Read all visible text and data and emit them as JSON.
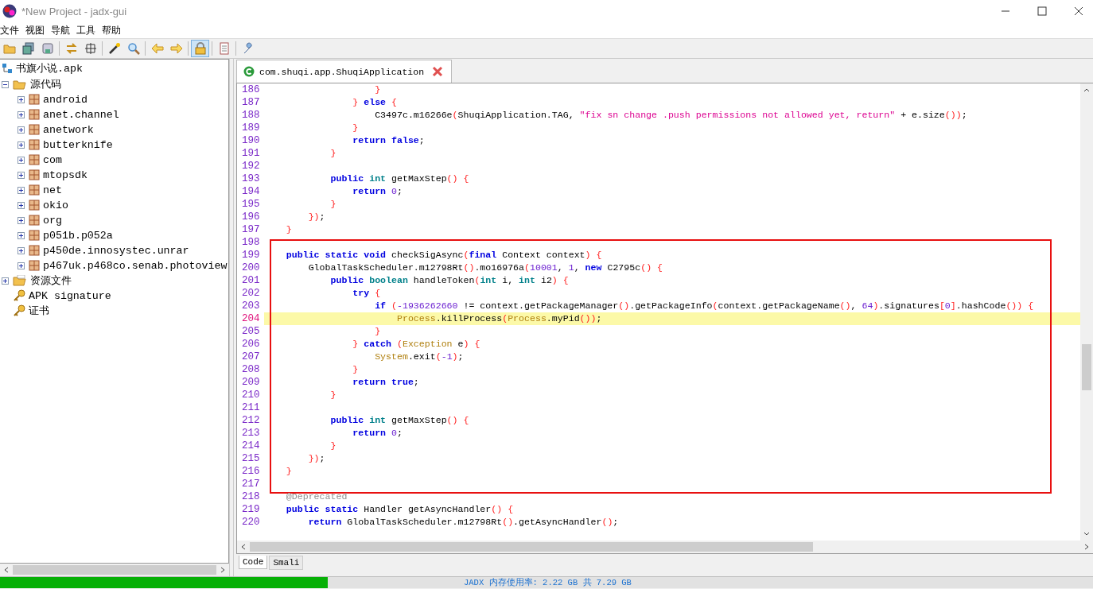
{
  "window": {
    "title": "*New Project - jadx-gui"
  },
  "menu": [
    "文件",
    "视图",
    "导航",
    "工具",
    "帮助"
  ],
  "toolbar": [
    [
      {
        "pressed": false
      },
      {
        "pressed": false
      },
      {
        "pressed": false
      }
    ],
    [
      {
        "pressed": false
      },
      {
        "pressed": false
      }
    ],
    [
      {
        "pressed": false
      },
      {
        "pressed": false
      }
    ],
    [
      {
        "pressed": false
      },
      {
        "pressed": false
      }
    ],
    [
      {
        "pressed": true
      }
    ],
    [
      {
        "pressed": false
      }
    ],
    [
      {
        "pressed": false
      }
    ]
  ],
  "tree": {
    "label": "书旗小说.apk",
    "children": [
      {
        "label": "源代码",
        "kind": "source",
        "expanded": true,
        "children": [
          {
            "label": "android",
            "kind": "package",
            "expanded": false
          },
          {
            "label": "anet.channel",
            "kind": "package",
            "expanded": false
          },
          {
            "label": "anetwork",
            "kind": "package",
            "expanded": false
          },
          {
            "label": "butterknife",
            "kind": "package",
            "expanded": false
          },
          {
            "label": "com",
            "kind": "package",
            "expanded": false
          },
          {
            "label": "mtopsdk",
            "kind": "package",
            "expanded": false
          },
          {
            "label": "net",
            "kind": "package",
            "expanded": false
          },
          {
            "label": "okio",
            "kind": "package",
            "expanded": false
          },
          {
            "label": "org",
            "kind": "package",
            "expanded": false
          },
          {
            "label": "p051b.p052a",
            "kind": "package",
            "expanded": false
          },
          {
            "label": "p450de.innosystec.unrar",
            "kind": "package",
            "expanded": false
          },
          {
            "label": "p467uk.p468co.senab.photoview",
            "kind": "package",
            "expanded": false
          }
        ]
      },
      {
        "label": "资源文件",
        "kind": "resources",
        "expanded": false
      },
      {
        "label": "APK signature",
        "kind": "key"
      },
      {
        "label": "证书",
        "kind": "key"
      }
    ]
  },
  "editor_tab": {
    "label": "com.shuqi.app.ShuqiApplication"
  },
  "code": {
    "sections": [
      {
        "boxed": false,
        "lines": [
          {
            "number": "186",
            "highlighted": false,
            "tokens": [
              {
                "kind": "bracket",
                "text": "                    }"
              }
            ]
          },
          {
            "number": "187",
            "highlighted": false,
            "tokens": [
              {
                "kind": "bracket",
                "text": "                }"
              },
              {
                "kind": "keyword",
                "text": " else"
              },
              {
                "kind": "bracket",
                "text": " {"
              }
            ]
          },
          {
            "number": "188",
            "highlighted": false,
            "tokens": [
              {
                "kind": "plain",
                "text": "                    C3497c.m16266e"
              },
              {
                "kind": "bracket",
                "text": "("
              },
              {
                "kind": "plain",
                "text": "ShuqiApplication.TAG,"
              },
              {
                "kind": "string",
                "text": " \"fix sn change .push permissions not allowed yet, return\""
              },
              {
                "kind": "plain",
                "text": " + e.size"
              },
              {
                "kind": "bracket",
                "text": "())"
              },
              {
                "kind": "plain",
                "text": ";"
              }
            ]
          },
          {
            "number": "189",
            "highlighted": false,
            "tokens": [
              {
                "kind": "bracket",
                "text": "                }"
              }
            ]
          },
          {
            "number": "190",
            "highlighted": false,
            "tokens": [
              {
                "kind": "keyword",
                "text": "                return false"
              },
              {
                "kind": "plain",
                "text": ";"
              }
            ]
          },
          {
            "number": "191",
            "highlighted": false,
            "tokens": [
              {
                "kind": "bracket",
                "text": "            }"
              }
            ]
          },
          {
            "number": "192",
            "highlighted": false
          },
          {
            "number": "193",
            "highlighted": false,
            "tokens": [
              {
                "kind": "keyword",
                "text": "            public"
              },
              {
                "kind": "type",
                "text": " int"
              },
              {
                "kind": "plain",
                "text": " getMaxStep"
              },
              {
                "kind": "bracket",
                "text": "() {"
              }
            ]
          },
          {
            "number": "194",
            "highlighted": false,
            "tokens": [
              {
                "kind": "keyword",
                "text": "                return"
              },
              {
                "kind": "number",
                "text": " 0"
              },
              {
                "kind": "plain",
                "text": ";"
              }
            ]
          },
          {
            "number": "195",
            "highlighted": false,
            "tokens": [
              {
                "kind": "bracket",
                "text": "            }"
              }
            ]
          },
          {
            "number": "196",
            "highlighted": false,
            "tokens": [
              {
                "kind": "bracket",
                "text": "        })"
              },
              {
                "kind": "plain",
                "text": ";"
              }
            ]
          },
          {
            "number": "197",
            "highlighted": false,
            "tokens": [
              {
                "kind": "bracket",
                "text": "    }"
              }
            ]
          }
        ]
      },
      {
        "boxed": true,
        "lines": [
          {
            "number": "198",
            "highlighted": false
          },
          {
            "number": "199",
            "highlighted": false,
            "tokens": [
              {
                "kind": "keyword",
                "text": "    public static void"
              },
              {
                "kind": "plain",
                "text": " checkSigAsync"
              },
              {
                "kind": "bracket",
                "text": "("
              },
              {
                "kind": "keyword",
                "text": "final"
              },
              {
                "kind": "plain",
                "text": " Context context"
              },
              {
                "kind": "bracket",
                "text": ") {"
              }
            ]
          },
          {
            "number": "200",
            "highlighted": false,
            "tokens": [
              {
                "kind": "plain",
                "text": "        GlobalTaskScheduler.m12798Rt"
              },
              {
                "kind": "bracket",
                "text": "()"
              },
              {
                "kind": "plain",
                "text": ".mo16976a"
              },
              {
                "kind": "bracket",
                "text": "("
              },
              {
                "kind": "number",
                "text": "10001"
              },
              {
                "kind": "plain",
                "text": ","
              },
              {
                "kind": "number",
                "text": " 1"
              },
              {
                "kind": "plain",
                "text": ","
              },
              {
                "kind": "keyword",
                "text": " new"
              },
              {
                "kind": "plain",
                "text": " C2795c"
              },
              {
                "kind": "bracket",
                "text": "() {"
              }
            ]
          },
          {
            "number": "201",
            "highlighted": false,
            "tokens": [
              {
                "kind": "keyword",
                "text": "            public"
              },
              {
                "kind": "type",
                "text": " boolean"
              },
              {
                "kind": "plain",
                "text": " handleToken"
              },
              {
                "kind": "bracket",
                "text": "("
              },
              {
                "kind": "type",
                "text": "int"
              },
              {
                "kind": "plain",
                "text": " i,"
              },
              {
                "kind": "type",
                "text": " int"
              },
              {
                "kind": "plain",
                "text": " i2"
              },
              {
                "kind": "bracket",
                "text": ") {"
              }
            ]
          },
          {
            "number": "202",
            "highlighted": false,
            "tokens": [
              {
                "kind": "keyword",
                "text": "                try"
              },
              {
                "kind": "bracket",
                "text": " {"
              }
            ]
          },
          {
            "number": "203",
            "highlighted": false,
            "tokens": [
              {
                "kind": "keyword",
                "text": "                    if"
              },
              {
                "kind": "bracket",
                "text": " ("
              },
              {
                "kind": "number",
                "text": "-1936262660"
              },
              {
                "kind": "plain",
                "text": " != context.getPackageManager"
              },
              {
                "kind": "bracket",
                "text": "()"
              },
              {
                "kind": "plain",
                "text": ".getPackageInfo"
              },
              {
                "kind": "bracket",
                "text": "("
              },
              {
                "kind": "plain",
                "text": "context.getPackageName"
              },
              {
                "kind": "bracket",
                "text": "()"
              },
              {
                "kind": "plain",
                "text": ","
              },
              {
                "kind": "number",
                "text": " 64"
              },
              {
                "kind": "bracket",
                "text": ")"
              },
              {
                "kind": "plain",
                "text": ".signatures"
              },
              {
                "kind": "bracket",
                "text": "["
              },
              {
                "kind": "number",
                "text": "0"
              },
              {
                "kind": "bracket",
                "text": "]"
              },
              {
                "kind": "plain",
                "text": ".hashCode"
              },
              {
                "kind": "bracket",
                "text": "()) {"
              }
            ]
          },
          {
            "number": "204",
            "highlighted": true,
            "tokens": [
              {
                "kind": "classname",
                "text": "                        Process"
              },
              {
                "kind": "plain",
                "text": ".killProcess"
              },
              {
                "kind": "bracket",
                "text": "("
              },
              {
                "kind": "classname",
                "text": "Process"
              },
              {
                "kind": "plain",
                "text": ".myPid"
              },
              {
                "kind": "bracket",
                "text": "())"
              },
              {
                "kind": "plain",
                "text": ";"
              }
            ]
          },
          {
            "number": "205",
            "highlighted": false,
            "tokens": [
              {
                "kind": "bracket",
                "text": "                    }"
              }
            ]
          },
          {
            "number": "206",
            "highlighted": false,
            "tokens": [
              {
                "kind": "bracket",
                "text": "                }"
              },
              {
                "kind": "keyword",
                "text": " catch"
              },
              {
                "kind": "bracket",
                "text": " ("
              },
              {
                "kind": "classname",
                "text": "Exception"
              },
              {
                "kind": "plain",
                "text": " e"
              },
              {
                "kind": "bracket",
                "text": ") {"
              }
            ]
          },
          {
            "number": "207",
            "highlighted": false,
            "tokens": [
              {
                "kind": "classname",
                "text": "                    System"
              },
              {
                "kind": "plain",
                "text": ".exit"
              },
              {
                "kind": "bracket",
                "text": "("
              },
              {
                "kind": "number",
                "text": "-1"
              },
              {
                "kind": "bracket",
                "text": ")"
              },
              {
                "kind": "plain",
                "text": ";"
              }
            ]
          },
          {
            "number": "208",
            "highlighted": false,
            "tokens": [
              {
                "kind": "bracket",
                "text": "                }"
              }
            ]
          },
          {
            "number": "209",
            "highlighted": false,
            "tokens": [
              {
                "kind": "keyword",
                "text": "                return true"
              },
              {
                "kind": "plain",
                "text": ";"
              }
            ]
          },
          {
            "number": "210",
            "highlighted": false,
            "tokens": [
              {
                "kind": "bracket",
                "text": "            }"
              }
            ]
          },
          {
            "number": "211",
            "highlighted": false
          },
          {
            "number": "212",
            "highlighted": false,
            "tokens": [
              {
                "kind": "keyword",
                "text": "            public"
              },
              {
                "kind": "type",
                "text": " int"
              },
              {
                "kind": "plain",
                "text": " getMaxStep"
              },
              {
                "kind": "bracket",
                "text": "() {"
              }
            ]
          },
          {
            "number": "213",
            "highlighted": false,
            "tokens": [
              {
                "kind": "keyword",
                "text": "                return"
              },
              {
                "kind": "number",
                "text": " 0"
              },
              {
                "kind": "plain",
                "text": ";"
              }
            ]
          },
          {
            "number": "214",
            "highlighted": false,
            "tokens": [
              {
                "kind": "bracket",
                "text": "            }"
              }
            ]
          },
          {
            "number": "215",
            "highlighted": false,
            "tokens": [
              {
                "kind": "bracket",
                "text": "        })"
              },
              {
                "kind": "plain",
                "text": ";"
              }
            ]
          },
          {
            "number": "216",
            "highlighted": false,
            "tokens": [
              {
                "kind": "bracket",
                "text": "    }"
              }
            ]
          },
          {
            "number": "217",
            "highlighted": false
          }
        ]
      },
      {
        "boxed": false,
        "lines": [
          {
            "number": "218",
            "highlighted": false,
            "tokens": [
              {
                "kind": "annotation",
                "text": "    @Deprecated"
              }
            ]
          },
          {
            "number": "219",
            "highlighted": false,
            "tokens": [
              {
                "kind": "keyword",
                "text": "    public static"
              },
              {
                "kind": "plain",
                "text": " Handler getAsyncHandler"
              },
              {
                "kind": "bracket",
                "text": "() {"
              }
            ]
          },
          {
            "number": "220",
            "highlighted": false,
            "tokens": [
              {
                "kind": "keyword",
                "text": "        return"
              },
              {
                "kind": "plain",
                "text": " GlobalTaskScheduler.m12798Rt"
              },
              {
                "kind": "bracket",
                "text": "()"
              },
              {
                "kind": "plain",
                "text": ".getAsyncHandler"
              },
              {
                "kind": "bracket",
                "text": "()"
              },
              {
                "kind": "plain",
                "text": ";"
              }
            ]
          }
        ]
      }
    ]
  },
  "view_tabs": [
    {
      "label": "Code",
      "selected": true
    },
    {
      "label": "Smali",
      "selected": false
    }
  ],
  "status_bar": {
    "memory": {
      "level": 0.3,
      "label": "JADX 内存使用率: 2.22 GB 共 7.29 GB"
    }
  }
}
